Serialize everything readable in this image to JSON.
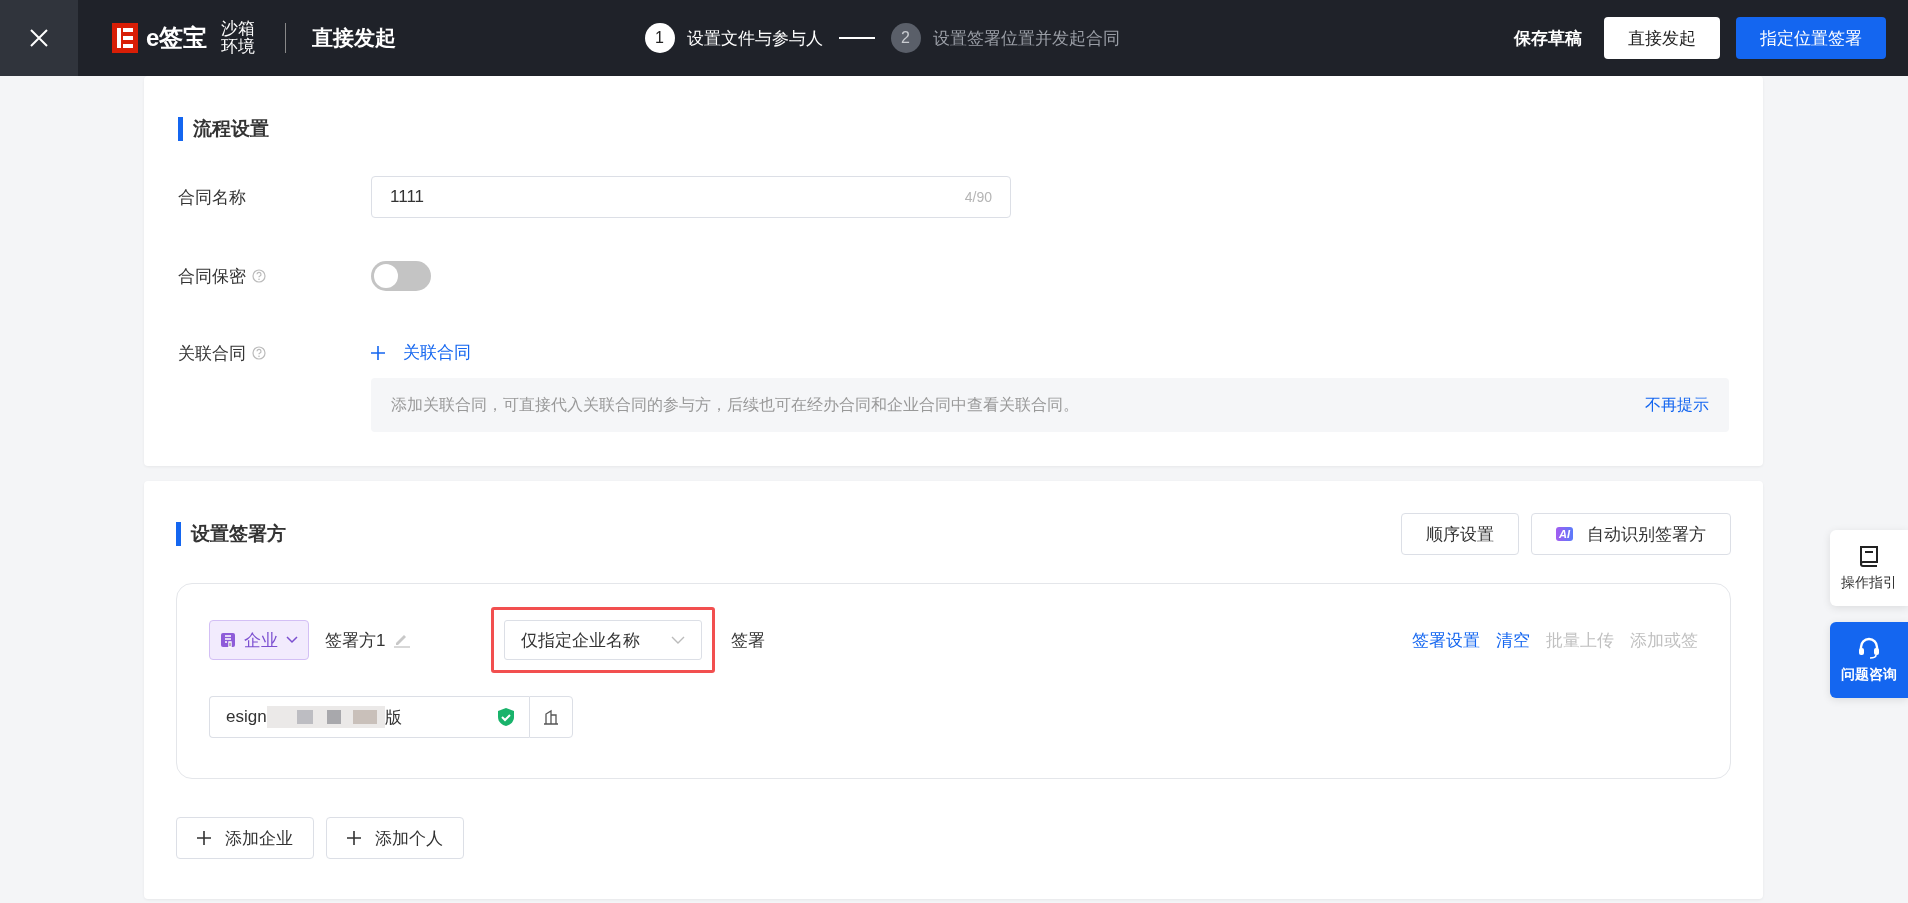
{
  "header": {
    "logo": "e签宝",
    "environment": "沙箱环境",
    "title": "直接发起",
    "steps": [
      {
        "number": "1",
        "label": "设置文件与参与人",
        "selected": true
      },
      {
        "number": "2",
        "label": "设置签署位置并发起合同",
        "selected": false
      }
    ],
    "actions": [
      {
        "label": "保存草稿",
        "kind": "text"
      },
      {
        "label": "直接发起",
        "kind": "outline"
      },
      {
        "label": "指定位置签署",
        "kind": "primary"
      }
    ]
  },
  "process": {
    "title": "流程设置",
    "contract_name": {
      "label": "合同名称",
      "value": "1111",
      "counter": "4/90"
    },
    "confidential": {
      "label": "合同保密",
      "on": false
    },
    "related": {
      "label": "关联合同",
      "action": "关联合同",
      "hint": "添加关联合同，可直接代入关联合同的参与方，后续也可在经办合同和企业合同中查看关联合同。",
      "dismiss": "不再提示"
    }
  },
  "signers": {
    "title": "设置签署方",
    "buttons": [
      {
        "label": "顺序设置",
        "kind": "plain"
      },
      {
        "label": "自动识别签署方",
        "kind": "ai",
        "badge": "AI"
      }
    ],
    "parties": [
      {
        "type": "企业",
        "name": "签署方1",
        "mode": "仅指定企业名称",
        "highlighted": true,
        "role": "签署",
        "links": [
          {
            "label": "签署设置",
            "disabled": false
          },
          {
            "label": "清空",
            "disabled": false
          },
          {
            "label": "批量上传",
            "disabled": true
          },
          {
            "label": "添加或签",
            "disabled": true
          }
        ],
        "org_prefix": "esign",
        "org_suffix": "版",
        "verified": true
      }
    ],
    "add_buttons": [
      "添加企业",
      "添加个人"
    ]
  },
  "side": [
    {
      "label": "操作指引",
      "kind": "guide"
    },
    {
      "label": "问题咨询",
      "kind": "help"
    }
  ]
}
